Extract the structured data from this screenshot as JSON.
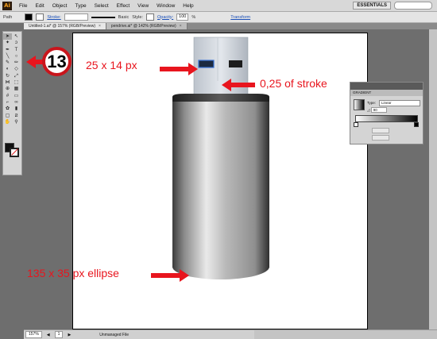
{
  "app": {
    "logo_text": "Ai",
    "menu": [
      "File",
      "Edit",
      "Object",
      "Type",
      "Select",
      "Effect",
      "View",
      "Window",
      "Help"
    ],
    "workspace": "ESSENTIALS"
  },
  "control_bar": {
    "selection_label": "Path",
    "stroke_label": "Stroke:",
    "brush_label": "Basic",
    "style_label": "Style:",
    "opacity_label": "Opacity:",
    "opacity_value": "100",
    "opacity_unit": "%",
    "transform_label": "Transform"
  },
  "tabs": [
    {
      "label": "Untitled-1.ai* @ 157% (RGB/Preview)",
      "active": true
    },
    {
      "label": "pendrive.ai* @ 142% (RGB/Preview)",
      "active": false
    }
  ],
  "status_bar": {
    "zoom": "157%",
    "page": "1",
    "status_text": "Unmanaged File"
  },
  "gradient_panel": {
    "tab_label": "GRADIENT",
    "type_label": "Type:",
    "type_value": "Linear",
    "angle_value": "90"
  },
  "annotations": {
    "step_number": "13",
    "label_rect": "25 x 14 px",
    "label_stroke": "0,25 of stroke",
    "label_ellipse": "135 x 35 px ellipse"
  },
  "colors": {
    "annotation_red": "#e8151e",
    "fill": "#000000",
    "stroke": "none"
  }
}
